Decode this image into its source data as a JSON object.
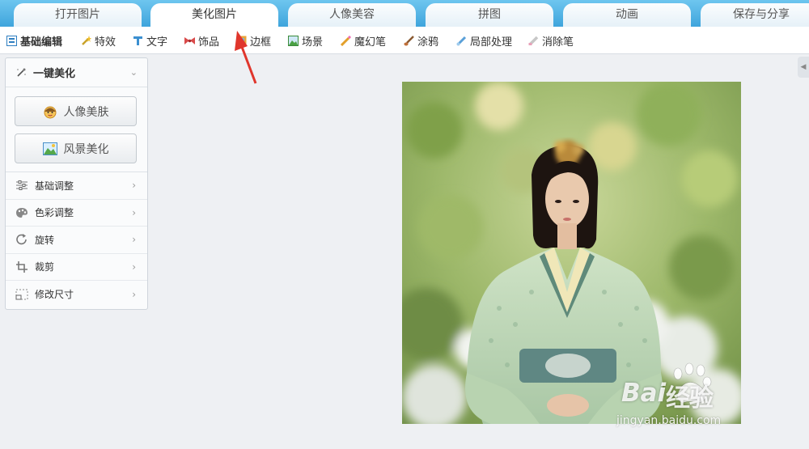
{
  "tabs": [
    {
      "label": "打开图片",
      "active": false
    },
    {
      "label": "美化图片",
      "active": true
    },
    {
      "label": "人像美容",
      "active": false
    },
    {
      "label": "拼图",
      "active": false
    },
    {
      "label": "动画",
      "active": false
    },
    {
      "label": "保存与分享",
      "active": false
    }
  ],
  "tools": [
    {
      "label": "基础编辑",
      "icon": "edit-icon",
      "active": true
    },
    {
      "label": "特效",
      "icon": "magic-wand-icon"
    },
    {
      "label": "文字",
      "icon": "text-t-icon"
    },
    {
      "label": "饰品",
      "icon": "bow-icon"
    },
    {
      "label": "边框",
      "icon": "frame-icon"
    },
    {
      "label": "场景",
      "icon": "landscape-icon"
    },
    {
      "label": "魔幻笔",
      "icon": "magic-pen-icon"
    },
    {
      "label": "涂鸦",
      "icon": "brush-icon"
    },
    {
      "label": "局部处理",
      "icon": "local-process-icon"
    },
    {
      "label": "消除笔",
      "icon": "eraser-pen-icon"
    }
  ],
  "panel": {
    "title": "一键美化",
    "buttons": [
      {
        "label": "人像美肤",
        "icon": "face-icon"
      },
      {
        "label": "风景美化",
        "icon": "picture-icon"
      }
    ],
    "menu": [
      {
        "label": "基础调整",
        "icon": "sliders-icon"
      },
      {
        "label": "色彩调整",
        "icon": "palette-icon"
      },
      {
        "label": "旋转",
        "icon": "rotate-icon"
      },
      {
        "label": "裁剪",
        "icon": "crop-icon"
      },
      {
        "label": "修改尺寸",
        "icon": "resize-icon"
      }
    ]
  },
  "watermark": {
    "brand_baidu": "Bai",
    "brand_cn": "经验",
    "url": "jingyan.baidu.com"
  }
}
